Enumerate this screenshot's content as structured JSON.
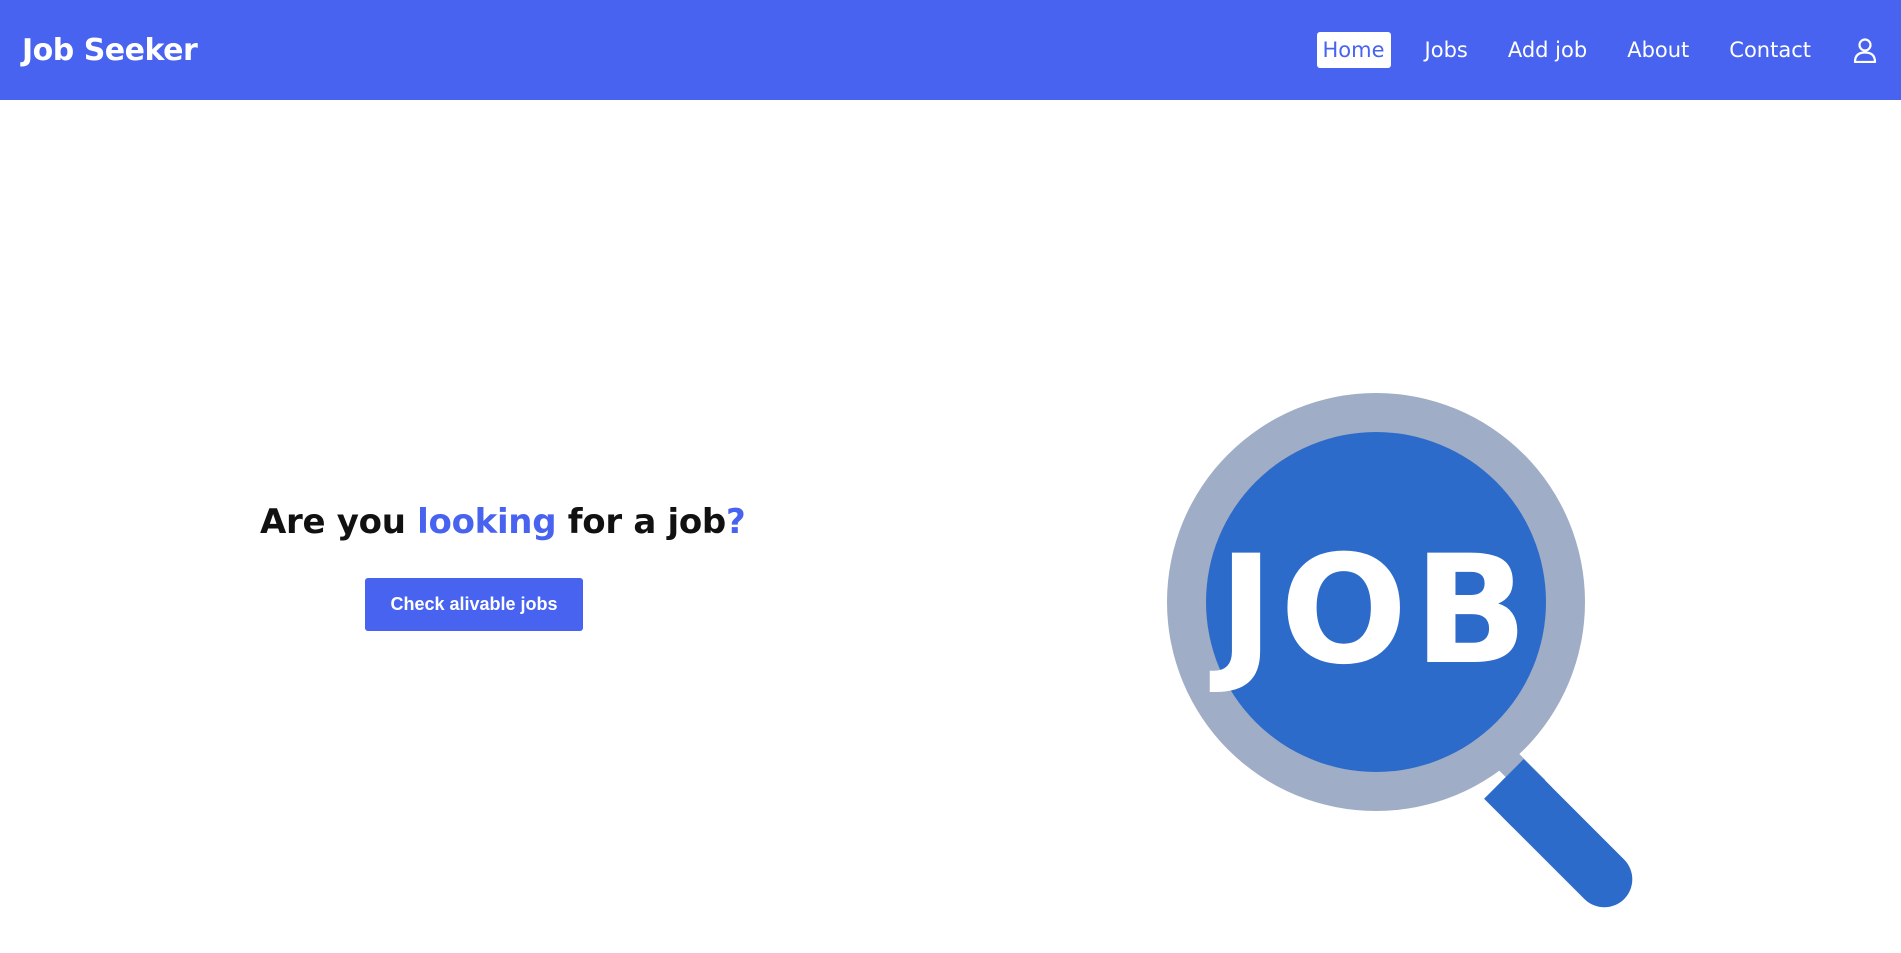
{
  "brand": {
    "name": "Job Seeker"
  },
  "nav": {
    "items": [
      {
        "label": "Home",
        "active": true
      },
      {
        "label": "Jobs",
        "active": false
      },
      {
        "label": "Add job",
        "active": false
      },
      {
        "label": "About",
        "active": false
      },
      {
        "label": "Contact",
        "active": false
      }
    ],
    "user_icon": "user-icon"
  },
  "hero": {
    "headline": {
      "part1": "Are you ",
      "accent1": "looking",
      "part2": " for a job",
      "accent2": "?"
    },
    "cta_label": "Check alivable jobs",
    "illustration_text": "JOB",
    "illustration_icon": "magnifier-icon"
  },
  "colors": {
    "brand_blue": "#4763f0",
    "lens_ring": "#9fadc6",
    "lens_fill": "#2d6bcb",
    "white": "#ffffff"
  }
}
